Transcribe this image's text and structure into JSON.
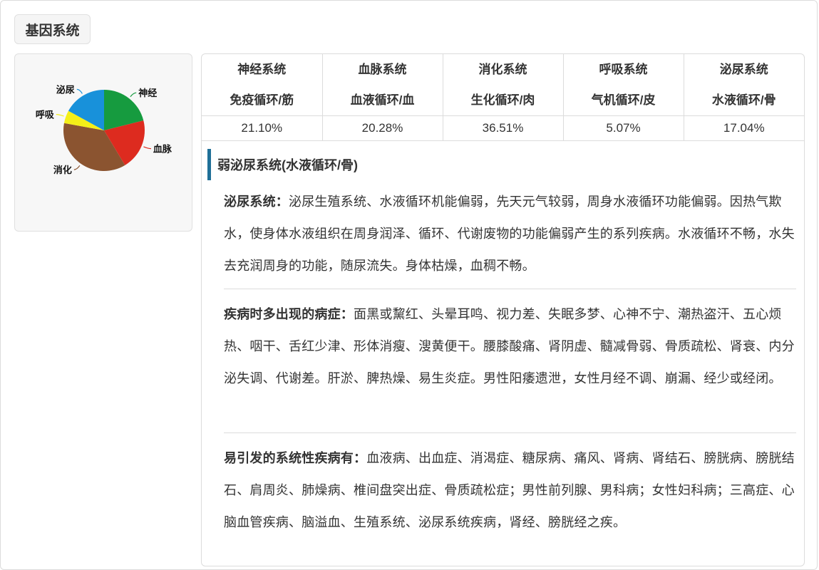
{
  "header": {
    "title": "基因系统"
  },
  "chart_data": {
    "type": "pie",
    "categories": [
      "神经",
      "血脉",
      "消化",
      "呼吸",
      "泌尿"
    ],
    "values": [
      21.1,
      20.28,
      36.51,
      5.07,
      17.04
    ],
    "colors": [
      "#169b3f",
      "#dd2b1f",
      "#8b5430",
      "#f4ef18",
      "#1891da"
    ]
  },
  "systems": [
    {
      "name": "神经系统",
      "sub": "免疫循环/筋",
      "percent": "21.10%"
    },
    {
      "name": "血脉系统",
      "sub": "血液循环/血",
      "percent": "20.28%"
    },
    {
      "name": "消化系统",
      "sub": "生化循环/肉",
      "percent": "36.51%"
    },
    {
      "name": "呼吸系统",
      "sub": "气机循环/皮",
      "percent": "5.07%"
    },
    {
      "name": "泌尿系统",
      "sub": "水液循环/骨",
      "percent": "17.04%"
    }
  ],
  "section": {
    "title": "弱泌尿系统(水液循环/骨)",
    "paragraphs": [
      {
        "label": "泌尿系统：",
        "text": "泌尿生殖系统、水液循环机能偏弱，先天元气较弱，周身水液循环功能偏弱。因热气欺水，使身体水液组织在周身润泽、循环、代谢废物的功能偏弱产生的系列疾病。水液循环不畅，水失去充润周身的功能，随尿流失。身体枯燥，血稠不畅。"
      },
      {
        "label": "疾病时多出现的病症：",
        "text": "面黑或黧红、头晕耳鸣、视力差、失眠多梦、心神不宁、潮热盗汗、五心烦热、咽干、舌红少津、形体消瘦、溲黄便干。腰膝酸痛、肾阴虚、髓减骨弱、骨质疏松、肾衰、内分泌失调、代谢差。肝淤、脾热燥、易生炎症。男性阳痿遗泄，女性月经不调、崩漏、经少或经闭。"
      },
      {
        "label": "易引发的系统性疾病有：",
        "text": "血液病、出血症、消渴症、糖尿病、痛风、肾病、肾结石、膀胱病、膀胱结石、肩周炎、肺燥病、椎间盘突出症、骨质疏松症；男性前列腺、男科病；女性妇科病；三高症、心脑血管疾病、脑溢血、生殖系统、泌尿系统疾病，肾经、膀胱经之疾。"
      }
    ]
  }
}
